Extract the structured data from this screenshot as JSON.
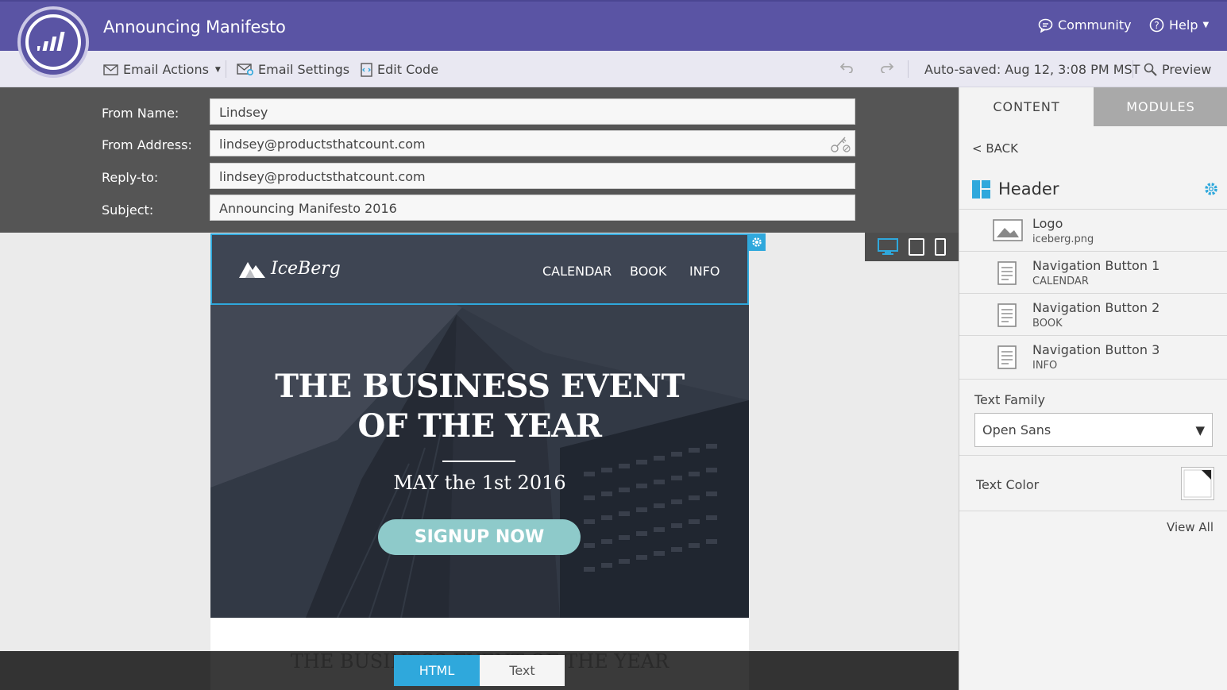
{
  "app": {
    "title": "Announcing Manifesto"
  },
  "topbar": {
    "community": "Community",
    "help": "Help"
  },
  "toolbar": {
    "email_actions": "Email Actions",
    "email_settings": "Email Settings",
    "edit_code": "Edit Code",
    "autosave": "Auto-saved: Aug 12, 3:08 PM MST",
    "preview": "Preview"
  },
  "header_fields": [
    {
      "label": "From Name:",
      "value": "Lindsey"
    },
    {
      "label": "From Address:",
      "value": "lindsey@productsthatcount.com"
    },
    {
      "label": "Reply-to:",
      "value": "lindsey@productsthatcount.com"
    },
    {
      "label": "Subject:",
      "value": "Announcing Manifesto 2016"
    }
  ],
  "email": {
    "brand": "IceBerg",
    "nav": [
      "CALENDAR",
      "BOOK",
      "INFO"
    ],
    "hero_title_line1": "THE BUSINESS EVENT",
    "hero_title_line2": "OF THE YEAR",
    "hero_date": "MAY the 1st 2016",
    "cta": "SIGNUP NOW",
    "ghost": "THE BUSINESS EVENT OF THE YEAR"
  },
  "bottom_tabs": {
    "html": "HTML",
    "text": "Text"
  },
  "sidebar": {
    "tab_content": "CONTENT",
    "tab_modules": "MODULES",
    "back": "< BACK",
    "section": "Header",
    "modules": [
      {
        "title": "Logo",
        "sub": "iceberg.png",
        "icon": "image-icon"
      },
      {
        "title": "Navigation Button 1",
        "sub": "CALENDAR",
        "icon": "document-icon"
      },
      {
        "title": "Navigation Button 2",
        "sub": "BOOK",
        "icon": "document-icon"
      },
      {
        "title": "Navigation Button 3",
        "sub": "INFO",
        "icon": "document-icon"
      }
    ],
    "text_family_label": "Text Family",
    "text_family_value": "Open Sans",
    "text_color_label": "Text Color",
    "view_all": "View All"
  },
  "colors": {
    "brand": "#5a54a4",
    "accent": "#2fa8dc",
    "cta": "#8ecaca"
  }
}
